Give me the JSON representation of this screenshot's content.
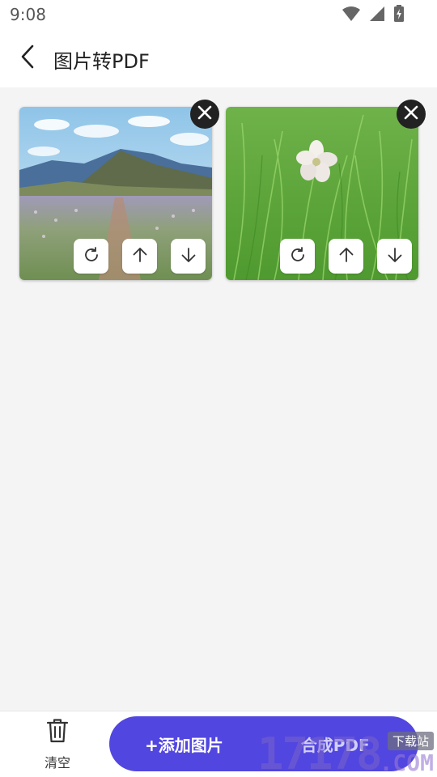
{
  "status_bar": {
    "time": "9:08",
    "icons": [
      "wifi-icon",
      "signal-icon",
      "battery-charging-icon"
    ]
  },
  "app_bar": {
    "title": "图片转PDF",
    "back_icon": "chevron-left-icon"
  },
  "images": [
    {
      "subject": "mountain-flower-field",
      "actions": [
        "rotate-icon",
        "arrow-up-icon",
        "arrow-down-icon"
      ],
      "remove_icon": "close-icon"
    },
    {
      "subject": "grass-white-flower",
      "actions": [
        "rotate-icon",
        "arrow-up-icon",
        "arrow-down-icon"
      ],
      "remove_icon": "close-icon"
    }
  ],
  "bottom_bar": {
    "clear_label": "清空",
    "add_label": "+添加图片",
    "merge_label": "合成PDF"
  },
  "watermark": {
    "digits": "17178",
    "domain": ".COM",
    "badge": "下载站"
  },
  "colors": {
    "primary": "#5246e0",
    "close_bg": "#222222",
    "background": "#f4f4f4"
  }
}
